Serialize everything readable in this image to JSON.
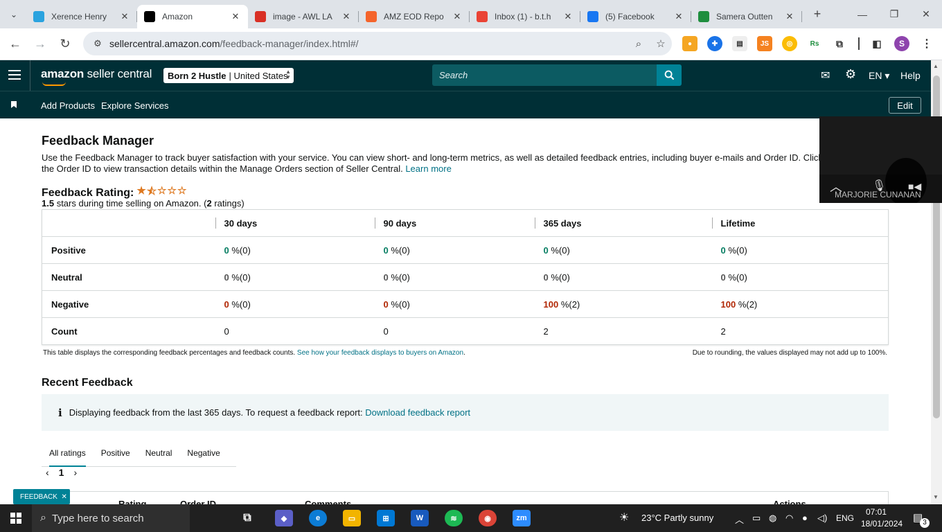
{
  "browser": {
    "tabs": [
      {
        "title": "Xerence Henry",
        "favicon": "telegram-icon",
        "color": "#2aa3df",
        "active": false
      },
      {
        "title": "Amazon",
        "favicon": "amazon-icon",
        "color": "#000000",
        "active": true
      },
      {
        "title": "image - AWL LA",
        "favicon": "triangle-icon",
        "color": "#d93025",
        "active": false
      },
      {
        "title": "AMZ EOD Repo",
        "favicon": "brush-icon",
        "color": "#f4642b",
        "active": false
      },
      {
        "title": "Inbox (1) - b.t.h",
        "favicon": "gmail-icon",
        "color": "#ea4335",
        "active": false
      },
      {
        "title": "(5) Facebook",
        "favicon": "facebook-icon",
        "color": "#1877f2",
        "active": false
      },
      {
        "title": "Samera Outten",
        "favicon": "sheets-icon",
        "color": "#1e8e3e",
        "active": false
      }
    ],
    "url_host": "sellercentral.amazon.com",
    "url_path": "/feedback-manager/index.html#/",
    "profile_initial": "S"
  },
  "header": {
    "logo_bold": "amazon",
    "logo_rest": " seller central",
    "account_name": "Born 2 Hustle",
    "account_region": "| United States",
    "search_placeholder": "Search",
    "language": "EN",
    "help": "Help",
    "nav_items": [
      "Add Products",
      "Explore Services"
    ],
    "edit": "Edit"
  },
  "page": {
    "title": "Feedback Manager",
    "intro_text": "Use the Feedback Manager to track buyer satisfaction with your service. You can view short- and long-term metrics, as well as detailed feedback entries, including buyer e-mails and Order ID. Click the Order ID to view transaction details within the Manage Orders section of Seller Central.",
    "learn_more": "Learn more",
    "rating_label": "Feedback Rating:",
    "rating_value": 1.5,
    "rating_max": 5,
    "rating_stars_text": "1.5",
    "rating_sub_text": " stars during time selling on Amazon. (",
    "rating_count": "2",
    "rating_sub_end": " ratings)",
    "table": {
      "columns": [
        "",
        "30 days",
        "90 days",
        "365 days",
        "Lifetime"
      ],
      "rows": [
        {
          "label": "Positive",
          "cells": [
            [
              "0",
              " %(0)"
            ],
            [
              "0",
              " %(0)"
            ],
            [
              "0",
              " %(0)"
            ],
            [
              "0",
              " %(0)"
            ]
          ],
          "tone": "g"
        },
        {
          "label": "Neutral",
          "cells": [
            [
              "0",
              " %(0)"
            ],
            [
              "0",
              " %(0)"
            ],
            [
              "0",
              " %(0)"
            ],
            [
              "0",
              " %(0)"
            ]
          ],
          "tone": "n"
        },
        {
          "label": "Negative",
          "cells": [
            [
              "0",
              " %(0)"
            ],
            [
              "0",
              " %(0)"
            ],
            [
              "100",
              " %(2)"
            ],
            [
              "100",
              " %(2)"
            ]
          ],
          "tone": "r"
        },
        {
          "label": "Count",
          "cells": [
            [
              "",
              "0"
            ],
            [
              "",
              "0"
            ],
            [
              "",
              "2"
            ],
            [
              "",
              "2"
            ]
          ],
          "tone": ""
        }
      ]
    },
    "note_left": "This table displays the corresponding feedback percentages and feedback counts.",
    "note_link": "See how your feedback displays to buyers on Amazon",
    "note_right": "Due to rounding, the values displayed may not add up to 100%.",
    "recent_title": "Recent Feedback",
    "info_text": "Displaying feedback from the last 365 days. To request a feedback report:",
    "info_link": "Download feedback report",
    "rating_tabs": [
      "All ratings",
      "Positive",
      "Neutral",
      "Negative"
    ],
    "page_number": "1",
    "feedback_badge": "FEEDBACK",
    "lower_headers": [
      "Rating",
      "Order ID",
      "Comments",
      "Actions"
    ]
  },
  "zoom": {
    "participant": "MARJORIE CUNANAN"
  },
  "taskbar": {
    "search_placeholder": "Type here to search",
    "weather": "23°C  Partly sunny",
    "lang": "ENG",
    "time": "07:01",
    "date": "18/01/2024",
    "notifications": "3"
  }
}
